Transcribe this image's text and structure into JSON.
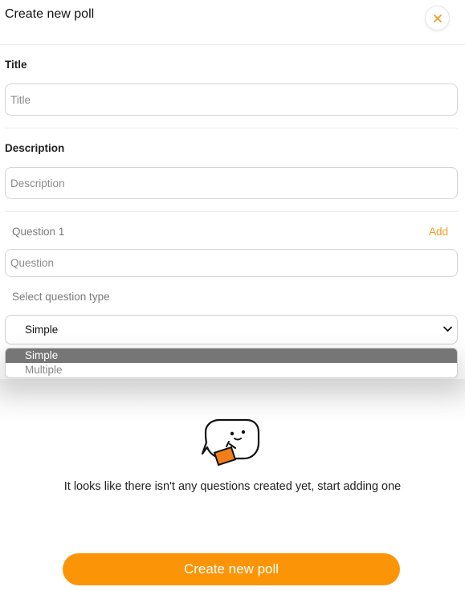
{
  "header": {
    "title": "Create new poll",
    "close_icon": "close-icon"
  },
  "form": {
    "title_label": "Title",
    "title_placeholder": "Title",
    "title_value": "",
    "description_label": "Description",
    "description_placeholder": "Description",
    "description_value": "",
    "question_label": "Question 1",
    "add_label": "Add",
    "question_placeholder": "Question",
    "question_value": "",
    "type_label": "Select question type",
    "type_selected": "Simple",
    "type_options": [
      "Simple",
      "Multiple"
    ]
  },
  "empty_state": {
    "icon": "speech-bubble-character-icon",
    "message": "It looks like there isn't any questions created yet, start adding one"
  },
  "footer": {
    "create_button_label": "Create new poll"
  },
  "colors": {
    "accent": "#fb9406",
    "link": "#f29a1f",
    "dropdown_selected": "#767676"
  }
}
